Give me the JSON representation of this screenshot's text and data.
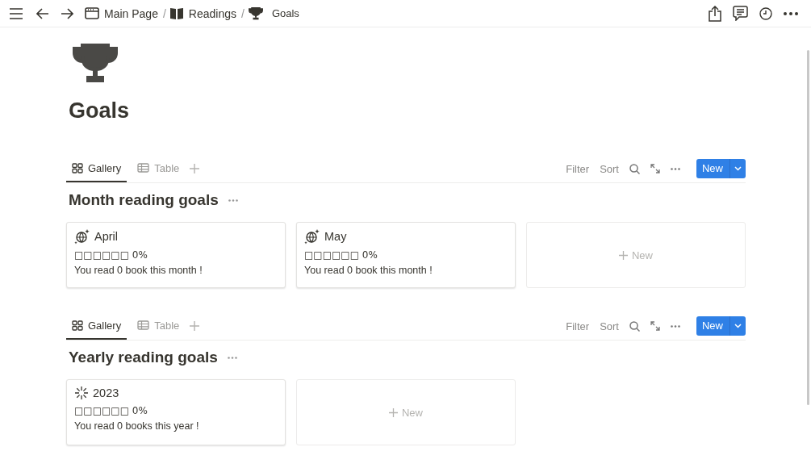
{
  "topbar": {
    "breadcrumbs": [
      {
        "label": "Main Page",
        "separator": "/"
      },
      {
        "label": "Readings",
        "separator": "/"
      },
      {
        "label": "Goals"
      }
    ]
  },
  "page": {
    "title": "Goals"
  },
  "sections": [
    {
      "tabs": [
        {
          "label": "Gallery",
          "selected": true
        },
        {
          "label": "Table",
          "selected": false
        }
      ],
      "tools": [
        "Filter",
        "Sort"
      ],
      "new_button": "New",
      "heading": "Month reading goals",
      "cards": [
        {
          "kind": "entry",
          "title": "April",
          "progress": "□□□□□□ 0%",
          "note": "You read 0 book this month !"
        },
        {
          "kind": "entry",
          "title": "May",
          "progress": "□□□□□□ 0%",
          "note": "You read 0 book this month !"
        },
        {
          "kind": "new",
          "title": "New"
        }
      ]
    },
    {
      "tabs": [
        {
          "label": "Gallery",
          "selected": true
        },
        {
          "label": "Table",
          "selected": false
        }
      ],
      "tools": [
        "Filter",
        "Sort"
      ],
      "new_button": "New",
      "heading": "Yearly reading goals",
      "cards": [
        {
          "kind": "entry",
          "title": "2023",
          "progress": "□□□□□□ 0%",
          "note": "You read 0 books this year !"
        },
        {
          "kind": "new",
          "title": "New"
        }
      ]
    }
  ]
}
